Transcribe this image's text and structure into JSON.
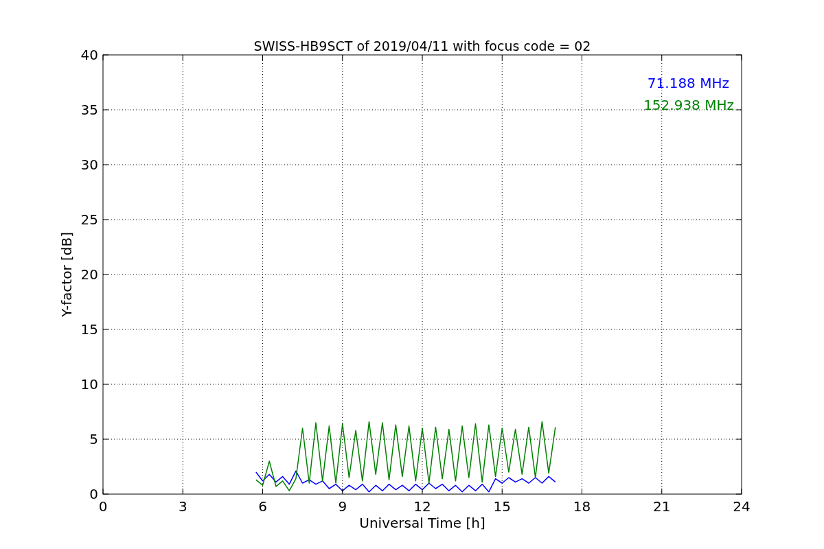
{
  "chart": {
    "chart_data": {
      "type": "line",
      "title": "SWISS-HB9SCT of 2019/04/11 with focus code = 02",
      "xlabel": "Universal Time [h]",
      "ylabel": "Y-factor [dB]",
      "x": [
        5.75,
        6,
        6.25,
        6.5,
        6.75,
        7,
        7.25,
        7.5,
        7.75,
        8,
        8.25,
        8.5,
        8.75,
        9,
        9.25,
        9.5,
        9.75,
        10,
        10.25,
        10.5,
        10.75,
        11,
        11.25,
        11.5,
        11.75,
        12,
        12.25,
        12.5,
        12.75,
        13,
        13.25,
        13.5,
        13.75,
        14,
        14.25,
        14.5,
        14.75,
        15,
        15.25,
        15.5,
        15.75,
        16,
        16.25,
        16.5,
        16.75,
        17
      ],
      "series": [
        {
          "name": "71.188 MHz",
          "color": "#0000ff",
          "values": [
            2.0,
            1.2,
            1.8,
            1.1,
            1.6,
            0.9,
            2.1,
            1.0,
            1.3,
            0.9,
            1.2,
            0.5,
            0.9,
            0.3,
            0.8,
            0.4,
            0.9,
            0.2,
            0.8,
            0.3,
            0.9,
            0.4,
            0.8,
            0.3,
            0.9,
            0.4,
            1.0,
            0.5,
            0.9,
            0.3,
            0.8,
            0.2,
            0.8,
            0.3,
            0.9,
            0.2,
            1.4,
            1.0,
            1.5,
            1.1,
            1.4,
            1.0,
            1.5,
            1.0,
            1.6,
            1.1
          ]
        },
        {
          "name": "152.938 MHz",
          "color": "#008000",
          "values": [
            1.3,
            0.8,
            3.0,
            0.7,
            1.2,
            0.3,
            1.4,
            6.0,
            1.0,
            6.5,
            1.2,
            6.2,
            1.0,
            6.4,
            1.5,
            5.8,
            1.2,
            6.6,
            1.8,
            6.5,
            1.3,
            6.3,
            1.6,
            6.2,
            1.2,
            6.0,
            1.0,
            6.1,
            1.4,
            5.9,
            1.2,
            6.2,
            1.5,
            6.4,
            1.1,
            6.3,
            1.6,
            6.0,
            2.0,
            5.9,
            1.8,
            6.1,
            1.5,
            6.6,
            1.9,
            6.1
          ]
        }
      ],
      "grid": true,
      "xlim": [
        0,
        24
      ],
      "ylim": [
        0,
        40
      ],
      "xticks": [
        0,
        3,
        6,
        9,
        12,
        15,
        18,
        21,
        24
      ],
      "yticks": [
        0,
        5,
        10,
        15,
        20,
        25,
        30,
        35,
        40
      ]
    }
  }
}
